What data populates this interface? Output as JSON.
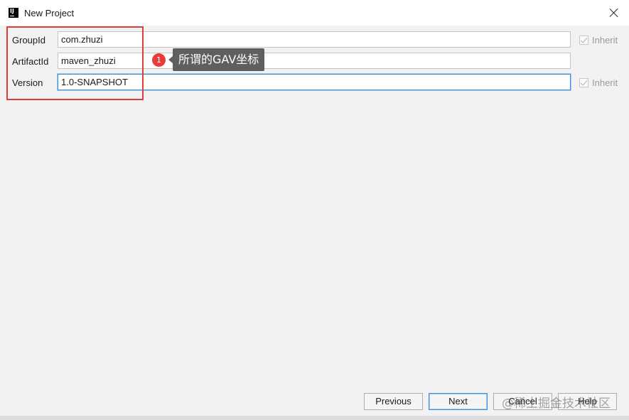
{
  "window": {
    "title": "New Project",
    "app_icon": "intellij-icon",
    "app_icon_text": "IJ",
    "close_icon": "close-icon"
  },
  "form": {
    "group_id": {
      "label": "GroupId",
      "value": "com.zhuzi",
      "inherit_label": "Inherit",
      "inherit_checked": true
    },
    "artifact_id": {
      "label": "ArtifactId",
      "value": "maven_zhuzi"
    },
    "version": {
      "label": "Version",
      "value": "1.0-SNAPSHOT",
      "inherit_label": "Inherit",
      "inherit_checked": true
    }
  },
  "annotation": {
    "badge_number": "1",
    "text": "所谓的GAV坐标",
    "highlight_color": "#e03c3c"
  },
  "buttons": {
    "previous": "Previous",
    "next": "Next",
    "cancel": "Cancel",
    "help": "Help"
  },
  "watermark": "@稀土掘金技术社区",
  "colors": {
    "focus_border": "#3c8fd8",
    "dialog_background": "#f2f2f2"
  }
}
